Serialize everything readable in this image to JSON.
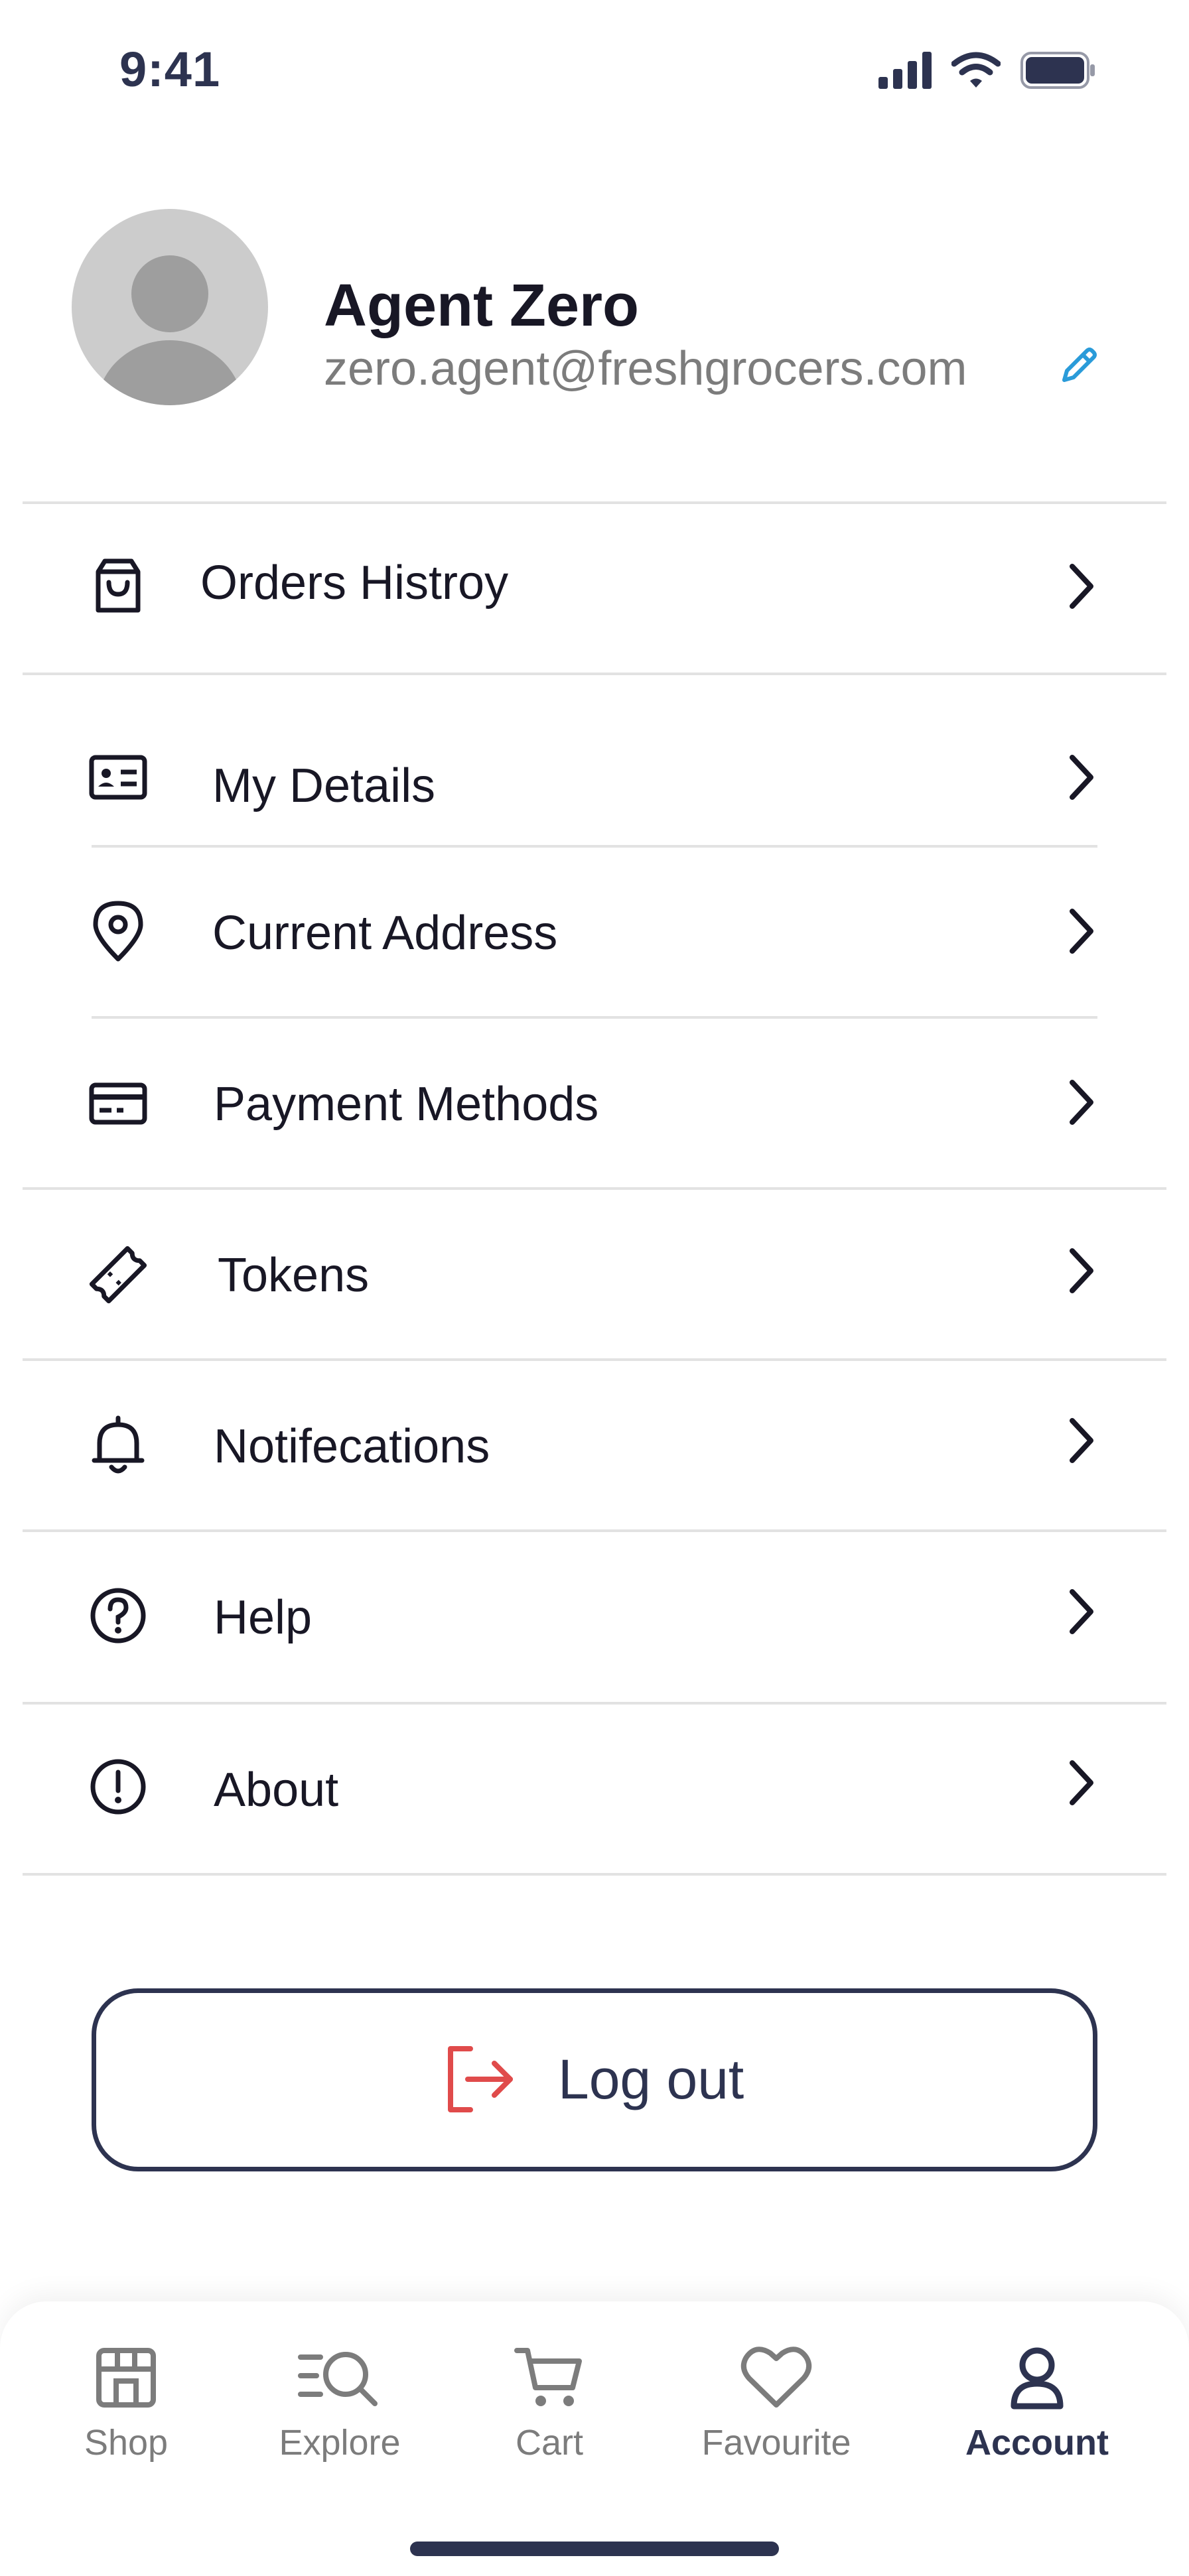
{
  "status_bar": {
    "time": "9:41"
  },
  "profile": {
    "name": "Agent Zero",
    "email": "zero.agent@freshgrocers.com"
  },
  "menu": [
    {
      "label": "Orders Histroy",
      "icon": "shopping-bag-icon"
    },
    {
      "label": "My Details",
      "icon": "id-card-icon"
    },
    {
      "label": "Current Address",
      "icon": "location-pin-icon"
    },
    {
      "label": "Payment Methods",
      "icon": "credit-card-icon"
    },
    {
      "label": "Tokens",
      "icon": "ticket-icon"
    },
    {
      "label": "Notifecations",
      "icon": "bell-icon"
    },
    {
      "label": "Help",
      "icon": "question-circle-icon"
    },
    {
      "label": "About",
      "icon": "info-circle-icon"
    }
  ],
  "logout": {
    "label": "Log out",
    "icon": "logout-icon",
    "icon_color": "#e04b4b"
  },
  "tabs": [
    {
      "label": "Shop",
      "icon": "store-icon",
      "active": false
    },
    {
      "label": "Explore",
      "icon": "explore-search-icon",
      "active": false
    },
    {
      "label": "Cart",
      "icon": "cart-icon",
      "active": false
    },
    {
      "label": "Favourite",
      "icon": "heart-icon",
      "active": false
    },
    {
      "label": "Account",
      "icon": "user-icon",
      "active": true
    }
  ],
  "colors": {
    "primary_text": "#181725",
    "secondary_text": "#7c7c7c",
    "navy": "#2d3350",
    "edit_icon": "#2a9bd9",
    "divider": "#e2e2e2"
  }
}
